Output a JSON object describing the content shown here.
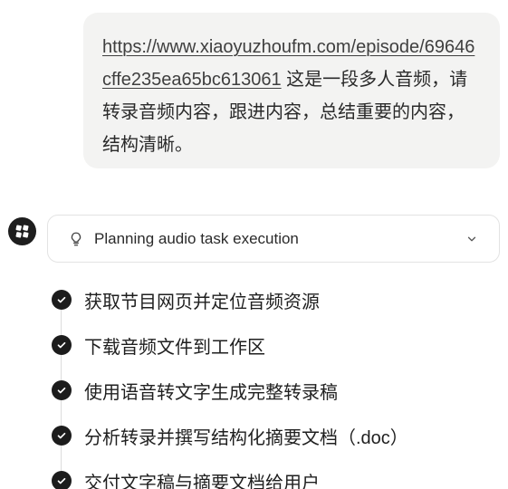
{
  "user_message": {
    "link_text": "https://www.xiaoyuzhoufm.com/episode/69646cffe235ea65bc613061",
    "text": " 这是一段多人音频，请转录音频内容，跟进内容，总结重要的内容，结构清晰。"
  },
  "assistant": {
    "avatar_icon": "assistant-logo-icon",
    "task": {
      "title": "Planning audio task execution",
      "icon": "lightbulb-icon",
      "toggle_icon": "chevron-down-icon"
    },
    "steps": [
      {
        "label": "获取节目网页并定位音频资源",
        "status": "done"
      },
      {
        "label": "下载音频文件到工作区",
        "status": "done"
      },
      {
        "label": "使用语音转文字生成完整转录稿",
        "status": "done"
      },
      {
        "label": "分析转录并撰写结构化摘要文档（.doc）",
        "status": "done"
      },
      {
        "label": "交付文字稿与摘要文档给用户",
        "status": "done"
      }
    ]
  },
  "colors": {
    "bubble_bg": "#f3f3f2",
    "check_bg": "#1c1c1c",
    "border": "#e3e3e3"
  }
}
